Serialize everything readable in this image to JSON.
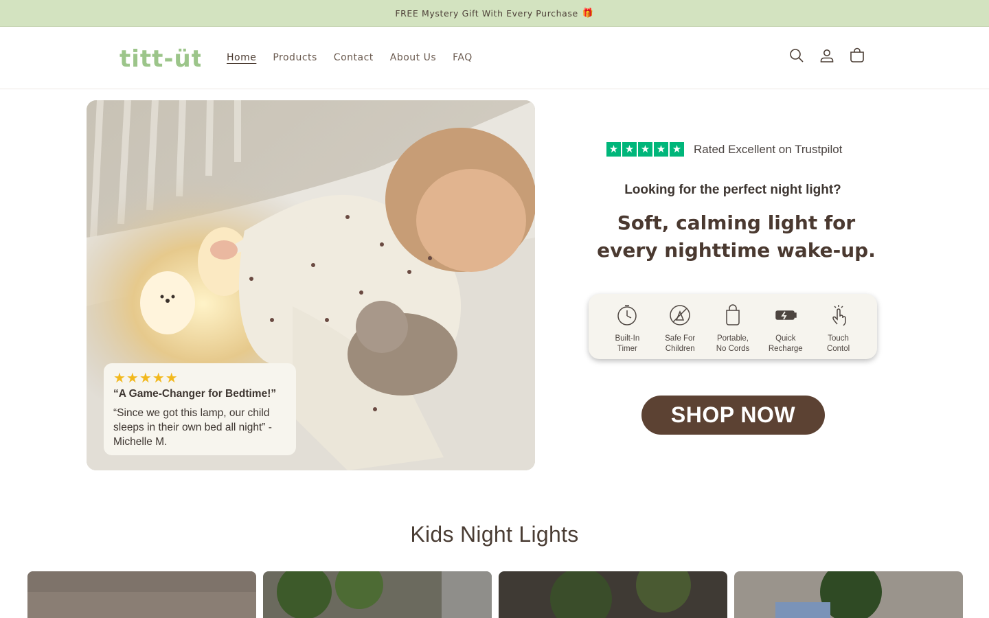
{
  "announcement": {
    "text": "FREE Mystery Gift With Every Purchase",
    "gift_glyph": "🎁"
  },
  "header": {
    "logo_text": "titt-üt",
    "nav": [
      {
        "label": "Home",
        "active": true
      },
      {
        "label": "Products",
        "active": false
      },
      {
        "label": "Contact",
        "active": false
      },
      {
        "label": "About Us",
        "active": false
      },
      {
        "label": "FAQ",
        "active": false
      }
    ],
    "icons": [
      "search-icon",
      "account-icon",
      "cart-icon"
    ]
  },
  "hero": {
    "review": {
      "stars": "★★★★★",
      "title": "“A Game-Changer for Bedtime!”",
      "body": "“Since we got this lamp, our child sleeps in their own bed all night” - Michelle M."
    },
    "trustpilot": {
      "stars": 5,
      "text": "Rated Excellent on Trustpilot",
      "color": "#00b67a"
    },
    "lead": "Looking for the perfect night light?",
    "headline": "Soft, calming light for every nighttime wake-up.",
    "features": [
      {
        "icon": "timer-icon",
        "label": "Built-In\nTimer"
      },
      {
        "icon": "safe-children-icon",
        "label": "Safe For\nChildren"
      },
      {
        "icon": "portable-icon",
        "label": "Portable,\nNo Cords"
      },
      {
        "icon": "battery-icon",
        "label": "Quick\nRecharge"
      },
      {
        "icon": "touch-icon",
        "label": "Touch\nContol"
      }
    ],
    "cta": "SHOP NOW",
    "cta_color": "#5c4233"
  },
  "collection": {
    "title": "Kids Night Lights"
  },
  "colors": {
    "announcement_bg": "#d3e3c0",
    "logo": "#9cc58a",
    "text": "#5a4a3f"
  }
}
